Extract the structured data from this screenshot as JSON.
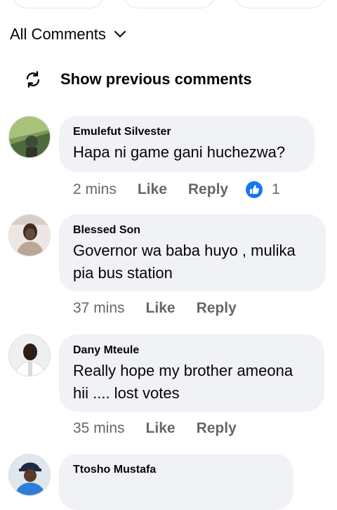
{
  "filter": {
    "label": "All Comments"
  },
  "previous": {
    "label": "Show previous comments"
  },
  "comments": [
    {
      "author": "Emulefut Silvester",
      "text": "Hapa ni game gani huchezwa?",
      "time": "2 mins",
      "like": "Like",
      "reply": "Reply",
      "reaction_count": "1"
    },
    {
      "author": "Blessed Son",
      "text": "Governor wa baba huyo , mulika pia bus station",
      "time": "37 mins",
      "like": "Like",
      "reply": "Reply"
    },
    {
      "author": "Dany Mteule",
      "text": "Really hope my brother ameona hii .... lost votes",
      "time": "35 mins",
      "like": "Like",
      "reply": "Reply"
    },
    {
      "author": "Ttosho Mustafa"
    }
  ],
  "colors": {
    "bubble": "#f0f2f5",
    "secondary_text": "#65676b",
    "like_blue": "#1877f2"
  }
}
